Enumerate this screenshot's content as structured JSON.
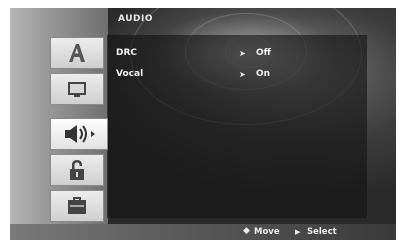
{
  "header": {
    "title": "AUDIO"
  },
  "tabs": [
    {
      "name": "language",
      "icon": "letter-a-icon",
      "selected": false
    },
    {
      "name": "display",
      "icon": "monitor-icon",
      "selected": false
    },
    {
      "name": "audio",
      "icon": "speaker-icon",
      "selected": true
    },
    {
      "name": "lock",
      "icon": "padlock-icon",
      "selected": false
    },
    {
      "name": "others",
      "icon": "briefcase-icon",
      "selected": false
    }
  ],
  "settings": [
    {
      "label": "DRC",
      "arrow": "➤",
      "value": "Off"
    },
    {
      "label": "Vocal",
      "arrow": "➤",
      "value": "On"
    }
  ],
  "footer": {
    "move_icon": "◆",
    "move_label": "Move",
    "select_icon": "▶",
    "select_label": "Select"
  }
}
